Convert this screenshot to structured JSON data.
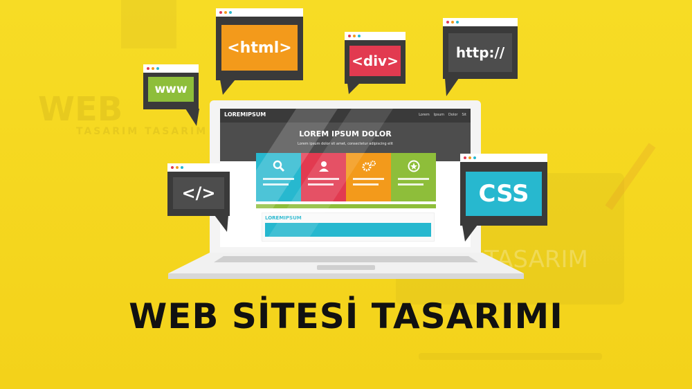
{
  "headline": "WEB SİTESİ TASARIMI",
  "bubbles": {
    "www": "www",
    "html": "<html>",
    "div": "<div>",
    "http": "http://",
    "code": "</>",
    "css": "CSS"
  },
  "site": {
    "logo": "LOREMIPSUM",
    "nav": [
      "Lorem",
      "Ipsum",
      "Dolor",
      "Sit"
    ],
    "hero_title": "LOREM IPSUM DOLOR",
    "hero_sub": "Lorem ipsum dolor sit amet, consectetur adipiscing elit",
    "section_title": "LOREMIPSUM"
  },
  "background": {
    "ghost_web": "WEB",
    "ghost_tasarim_small": "TASARIM TASARIM",
    "ghost_tasarim": "TASARIM"
  },
  "colors": {
    "background": "#f6d81e",
    "html": "#f39a1b",
    "div": "#e23a50",
    "www": "#8ebe3a",
    "css": "#27b8cf",
    "dark": "#3a3a3a"
  }
}
